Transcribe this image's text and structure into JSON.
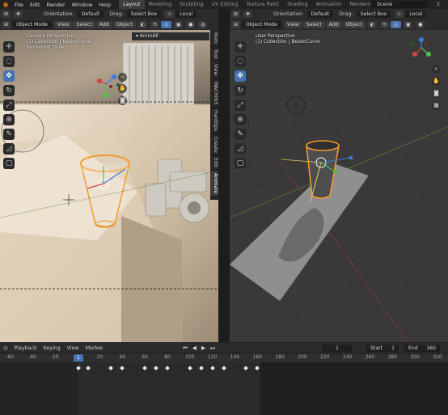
{
  "topbar": {
    "menus": [
      "File",
      "Edit",
      "Render",
      "Window",
      "Help"
    ],
    "workspaces": [
      {
        "label": "Layout",
        "active": true
      },
      {
        "label": "Modeling",
        "active": false
      },
      {
        "label": "Sculpting",
        "active": false
      },
      {
        "label": "UV Editing",
        "active": false
      },
      {
        "label": "Texture Paint",
        "active": false
      },
      {
        "label": "Shading",
        "active": false
      },
      {
        "label": "Animation",
        "active": false
      },
      {
        "label": "Rendering",
        "active": false
      },
      {
        "label": "Comp",
        "active": false
      }
    ],
    "scene": "Scene",
    "scene_num": "2"
  },
  "left": {
    "tool_header": {
      "orientation_label": "Orientation:",
      "orientation_value": "Default",
      "drag_label": "Drag:",
      "drag_value": "Select Box",
      "transform_value": "Local"
    },
    "view_header": {
      "mode": "Object Mode",
      "view": "View",
      "select": "Select",
      "add": "Add",
      "object": "Object"
    },
    "info": [
      "Camera Perspective",
      "(1) Collection | BezierCurve",
      "Rendering Done"
    ],
    "panel_title": "AnimAll",
    "side_tabs": [
      "Item",
      "Tool",
      "View",
      "MACHIN3",
      "HardOps",
      "Create",
      "Edit",
      "Animate"
    ],
    "tools": [
      "cursor",
      "select",
      "move",
      "rotate",
      "scale",
      "transform",
      "annotate",
      "measure",
      "add-cube"
    ]
  },
  "right": {
    "tool_header": {
      "orientation_label": "Orientation:",
      "orientation_value": "Default",
      "drag_label": "Drag:",
      "drag_value": "Select Box",
      "transform_value": "Local"
    },
    "view_header": {
      "mode": "Object Mode",
      "view": "View",
      "select": "Select",
      "add": "Add",
      "object": "Object"
    },
    "info": [
      "User Perspective",
      "(1) Collection | BezierCurve"
    ]
  },
  "timeline": {
    "menus": [
      "Playback",
      "Keying",
      "View",
      "Marker"
    ],
    "current_frame": "1",
    "start_label": "Start",
    "start": "1",
    "end_label": "End",
    "end": "160",
    "ruler": [
      "-60",
      "-40",
      "-20",
      "0",
      "20",
      "40",
      "60",
      "80",
      "100",
      "120",
      "140",
      "160",
      "180",
      "200",
      "220",
      "240",
      "260",
      "280",
      "300",
      "320"
    ],
    "playhead": "1",
    "keyframes": [
      1,
      10,
      30,
      40,
      60,
      70,
      80,
      100,
      110,
      120,
      130,
      150,
      160
    ]
  }
}
